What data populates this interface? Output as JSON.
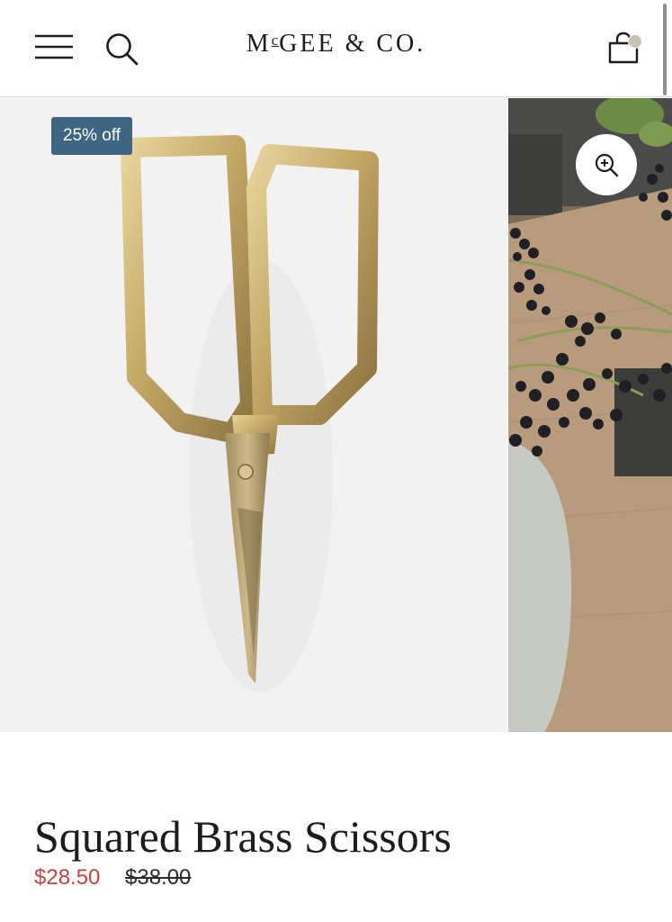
{
  "header": {
    "brand": {
      "mc_prefix": "M",
      "mc_superscript": "c",
      "rest": "GEE & CO."
    },
    "menu_icon": "hamburger-menu-icon",
    "search_icon": "search-icon",
    "cart_icon": "shopping-bag-icon",
    "cart_indicator_color": "#c9c2b4"
  },
  "gallery": {
    "badge": "25% off",
    "badge_color": "#3e6582",
    "zoom_icon": "zoom-in-icon"
  },
  "product": {
    "title": "Squared Brass Scissors",
    "sale_price": "$28.50",
    "original_price": "$38.00",
    "sale_price_color": "#c0463a"
  }
}
